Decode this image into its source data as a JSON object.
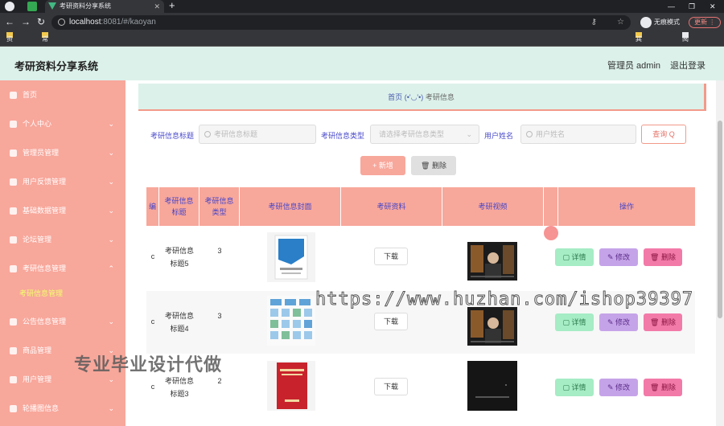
{
  "browser": {
    "tab_title": "考研资料分享系统",
    "url_host": "localhost",
    "url_path": ":8081/#/kaoyan",
    "incognito_label": "无痕模式",
    "update_label": "更新",
    "bookmarks": [
      "资料",
      "常用"
    ],
    "bookmarks_right": [
      "其他书签",
      "阅读清单"
    ]
  },
  "header": {
    "title": "考研资料分享系统",
    "admin": "管理员 admin",
    "logout": "退出登录"
  },
  "sidebar": {
    "items": [
      {
        "label": "首页",
        "icon": "home-icon",
        "chevron": ""
      },
      {
        "label": "个人中心",
        "icon": "user-icon",
        "chevron": "⌄"
      },
      {
        "label": "管理员管理",
        "icon": "clipboard-icon",
        "chevron": "⌄"
      },
      {
        "label": "用户反馈管理",
        "icon": "send-icon",
        "chevron": "⌄"
      },
      {
        "label": "基础数据管理",
        "icon": "phone-icon",
        "chevron": "⌄"
      },
      {
        "label": "论坛管理",
        "icon": "location-icon",
        "chevron": "⌄"
      },
      {
        "label": "考研信息管理",
        "icon": "chat-icon",
        "chevron": "⌃"
      },
      {
        "label": "公告信息管理",
        "icon": "clock-icon",
        "chevron": "⌄"
      },
      {
        "label": "商品管理",
        "icon": "user-icon",
        "chevron": "⌄"
      },
      {
        "label": "用户管理",
        "icon": "chart-icon",
        "chevron": "⌄"
      },
      {
        "label": "轮播图信息",
        "icon": "window-icon",
        "chevron": "⌄"
      }
    ],
    "active_sub": "考研信息管理"
  },
  "breadcrumb": {
    "home": "首页",
    "face": "(•'◡'•)",
    "current": "考研信息"
  },
  "filters": {
    "title_label": "考研信息标题",
    "title_placeholder": "考研信息标题",
    "type_label": "考研信息类型",
    "type_placeholder": "请选择考研信息类型",
    "user_label": "用户姓名",
    "user_placeholder": "用户姓名",
    "query_button": "查询 Q"
  },
  "actions": {
    "add": "+ 新增",
    "delete": "🗑 删除"
  },
  "table": {
    "headers": [
      "编",
      "考研信息\n标题",
      "考研信息\n类型",
      "考研信息封面",
      "考研资料",
      "考研视频",
      "",
      "操作"
    ],
    "rows": [
      {
        "idx": "c",
        "title": "考研信息\n标题5",
        "type": "3",
        "download": "下载",
        "detail": "详情",
        "edit": "修改",
        "remove": "删除"
      },
      {
        "idx": "c",
        "title": "考研信息\n标题4",
        "type": "3",
        "download": "下载",
        "detail": "详情",
        "edit": "修改",
        "remove": "删除"
      },
      {
        "idx": "c",
        "title": "考研信息\n标题3",
        "type": "2",
        "download": "下载",
        "detail": "详情",
        "edit": "修改",
        "remove": "删除"
      }
    ]
  },
  "watermarks": {
    "url": "https://www.huzhan.com/ishop39397",
    "promo": "专业毕业设计代做"
  }
}
